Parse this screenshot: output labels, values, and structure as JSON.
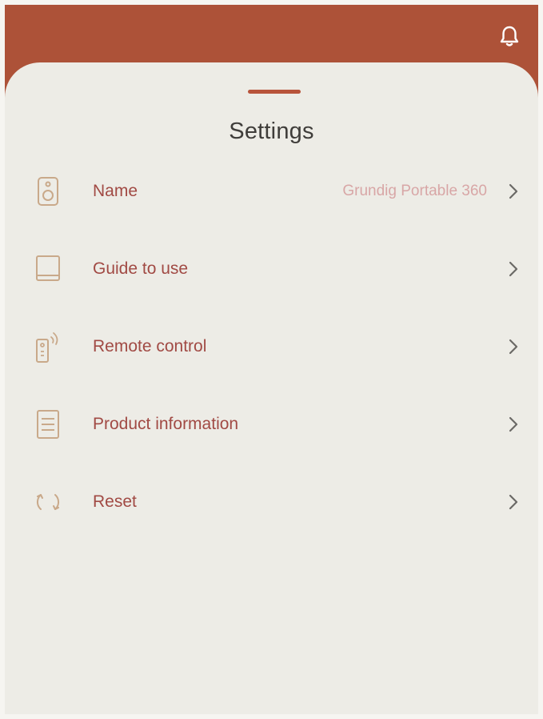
{
  "header": {
    "bell_icon": "bell-icon",
    "bar_color": "#ad5238"
  },
  "sheet": {
    "title": "Settings",
    "handle_color": "#b8543b"
  },
  "settings": [
    {
      "id": "name",
      "label": "Name",
      "value": "Grundig Portable 360",
      "icon": "speaker-icon"
    },
    {
      "id": "guide",
      "label": "Guide to use",
      "value": "",
      "icon": "book-icon"
    },
    {
      "id": "remote",
      "label": "Remote control",
      "value": "",
      "icon": "remote-icon"
    },
    {
      "id": "product",
      "label": "Product information",
      "value": "",
      "icon": "document-icon"
    },
    {
      "id": "reset",
      "label": "Reset",
      "value": "",
      "icon": "reset-icon"
    }
  ],
  "colors": {
    "label": "#a14a44",
    "value": "#d8a6a6",
    "icon": "#c9a98a",
    "chevron": "#6b6966"
  }
}
